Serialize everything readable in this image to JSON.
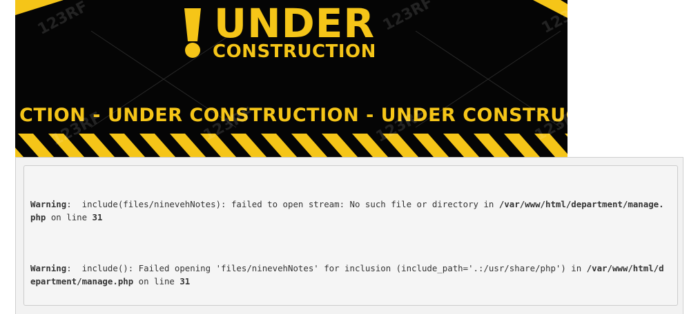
{
  "banner": {
    "title": "UNDER",
    "subtitle": "CONSTRUCTION",
    "ribbon_text": "CTION - UNDER  CONSTRUCTION - UNDER  CONSTRUCTION - UNDER  CONS",
    "watermark": "123RF",
    "colors": {
      "yellow": "#f5c518",
      "black": "#050505"
    }
  },
  "errors": [
    {
      "label": "Warning",
      "message": "include(files/ninevehNotes): failed to open stream: No such file or directory in ",
      "path": "/var/www/html/department/manage.php",
      "on_line": " on line ",
      "line": "31"
    },
    {
      "label": "Warning",
      "message": "include(): Failed opening 'files/ninevehNotes' for inclusion (include_path='.:/usr/share/php') in ",
      "path": "/var/www/html/department/manage.php",
      "on_line": " on line ",
      "line": "31"
    }
  ]
}
